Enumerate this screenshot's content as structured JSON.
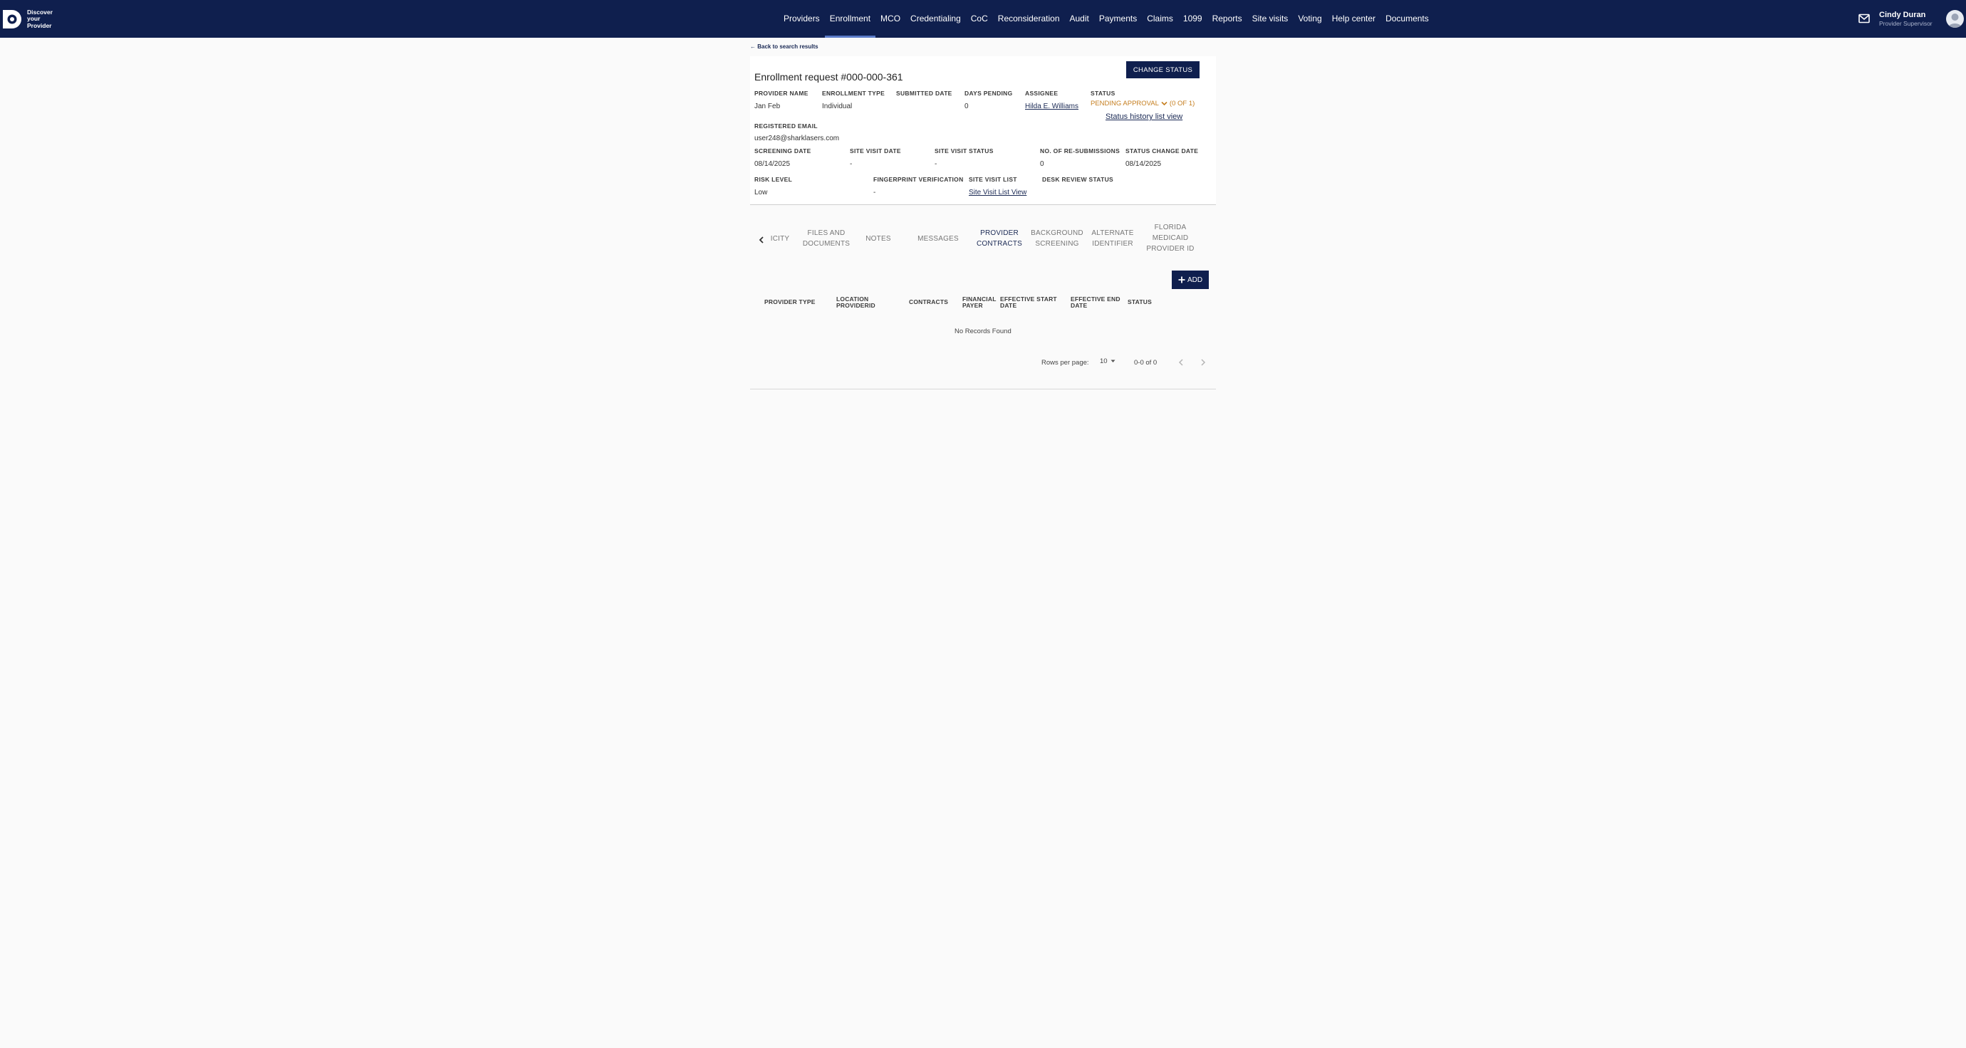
{
  "brand": {
    "logo_lines": [
      "Discover",
      "your",
      "Provider"
    ]
  },
  "nav": {
    "items": [
      "Providers",
      "Enrollment",
      "MCO",
      "Credentialing",
      "CoC",
      "Reconsideration",
      "Audit",
      "Payments",
      "Claims",
      "1099",
      "Reports",
      "Site visits",
      "Voting",
      "Help center",
      "Documents"
    ],
    "active": "Enrollment"
  },
  "user": {
    "name": "Cindy Duran",
    "role": "Provider Supervisor"
  },
  "back_link": "← Back to search results",
  "request": {
    "title": "Enrollment request #000-000-361",
    "change_status_label": "CHANGE STATUS",
    "fields": {
      "provider_name_label": "PROVIDER NAME",
      "provider_name": "Jan Feb",
      "enrollment_type_label": "ENROLLMENT TYPE",
      "enrollment_type": "Individual",
      "submitted_date_label": "SUBMITTED DATE",
      "days_pending_label": "DAYS PENDING",
      "days_pending": "0",
      "assignee_label": "ASSIGNEE",
      "assignee": "Hilda E. Williams",
      "status_label": "STATUS",
      "status_value": "PENDING APPROVAL",
      "status_count": "(0 OF 1)",
      "status_history_link": "Status history list view",
      "registered_email_label": "REGISTERED EMAIL",
      "registered_email": "user248@sharklasers.com",
      "screening_date_label": "SCREENING DATE",
      "screening_date": "08/14/2025",
      "site_visit_date_label": "SITE VISIT DATE",
      "site_visit_date": "-",
      "site_visit_status_label": "SITE VISIT STATUS",
      "site_visit_status": "-",
      "resubmissions_label": "NO. OF RE-SUBMISSIONS",
      "resubmissions": "0",
      "status_change_date_label": "STATUS CHANGE DATE",
      "status_change_date": "08/14/2025",
      "risk_level_label": "RISK LEVEL",
      "risk_level": "Low",
      "fingerprint_label": "FINGERPRINT VERIFICATION",
      "fingerprint": "-",
      "site_visit_list_label": "SITE VISIT LIST",
      "site_visit_list_link": "Site Visit List View",
      "desk_review_label": "DESK REVIEW STATUS"
    }
  },
  "tabs": {
    "items": [
      "ICITY",
      "FILES AND DOCUMENTS",
      "NOTES",
      "MESSAGES",
      "PROVIDER CONTRACTS",
      "BACKGROUND SCREENING",
      "ALTERNATE IDENTIFIER",
      "FLORIDA MEDICAID PROVIDER ID"
    ],
    "active": "PROVIDER CONTRACTS"
  },
  "contracts": {
    "add_label": "ADD",
    "columns": [
      "PROVIDER TYPE",
      "LOCATION PROVIDERID",
      "CONTRACTS",
      "FINANCIAL PAYER",
      "EFFECTIVE START DATE",
      "EFFECTIVE END DATE",
      "STATUS"
    ],
    "empty_text": "No Records Found",
    "rows_per_page_label": "Rows per page:",
    "rows_per_page": "10",
    "range_text": "0-0 of 0"
  },
  "colors": {
    "nav_bg": "#0f1f4e",
    "status_pending": "#c57e1f",
    "link": "#1b2a55"
  }
}
